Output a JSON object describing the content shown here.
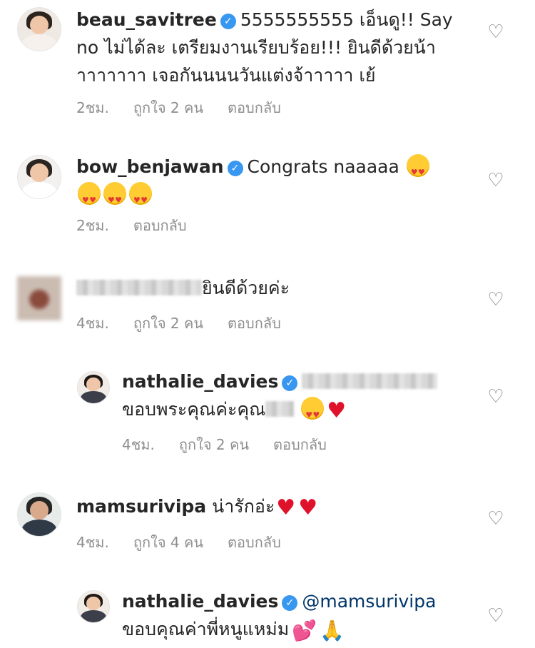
{
  "comments": [
    {
      "username": "beau_savitree",
      "text": "5555555555 เอ็นดู!! Say\nno ไม่ได้ละ เตรียมงานเรียบร้อย!!! ยินดีด้วยน้า\nาาาาาาา เจอกันนนนวันแต่งจ้าาาาา เย้",
      "time": "2ชม.",
      "likes": "ถูกใจ 2 คน",
      "reply": "ตอบกลับ",
      "verified": true
    },
    {
      "username": "bow_benjawan",
      "text": "Congrats naaaaa",
      "time": "2ชม.",
      "reply": "ตอบกลับ",
      "verified": true
    },
    {
      "username": "",
      "text": "ยินดีด้วยค่ะ",
      "time": "4ชม.",
      "likes": "ถูกใจ 2 คน",
      "reply": "ตอบกลับ",
      "verified": false
    },
    {
      "username": "nathalie_davies",
      "text": "ขอบพระคุณค่ะคุณ",
      "time": "4ชม.",
      "likes": "ถูกใจ 2 คน",
      "reply": "ตอบกลับ",
      "verified": true
    },
    {
      "username": "mamsurivipa",
      "text": "น่ารักอ่ะ",
      "time": "4ชม.",
      "likes": "ถูกใจ 4 คน",
      "reply": "ตอบกลับ",
      "verified": false
    },
    {
      "username": "nathalie_davies",
      "mention": "@mamsurivipa",
      "text": "ขอบคุณค่าพี่หนูแหม่ม",
      "verified": true
    }
  ],
  "icons": {
    "verified": "verified-badge-icon",
    "like": "heart-outline-icon",
    "heart_emoji": "red-heart-emoji",
    "heart_eyes_emoji": "heart-eyes-emoji",
    "two_hearts_emoji": "two-hearts-emoji",
    "pray_emoji": "folded-hands-emoji"
  },
  "colors": {
    "text": "#262626",
    "meta": "#8e8e8e",
    "verified": "#3897f0",
    "mention": "#003569"
  }
}
